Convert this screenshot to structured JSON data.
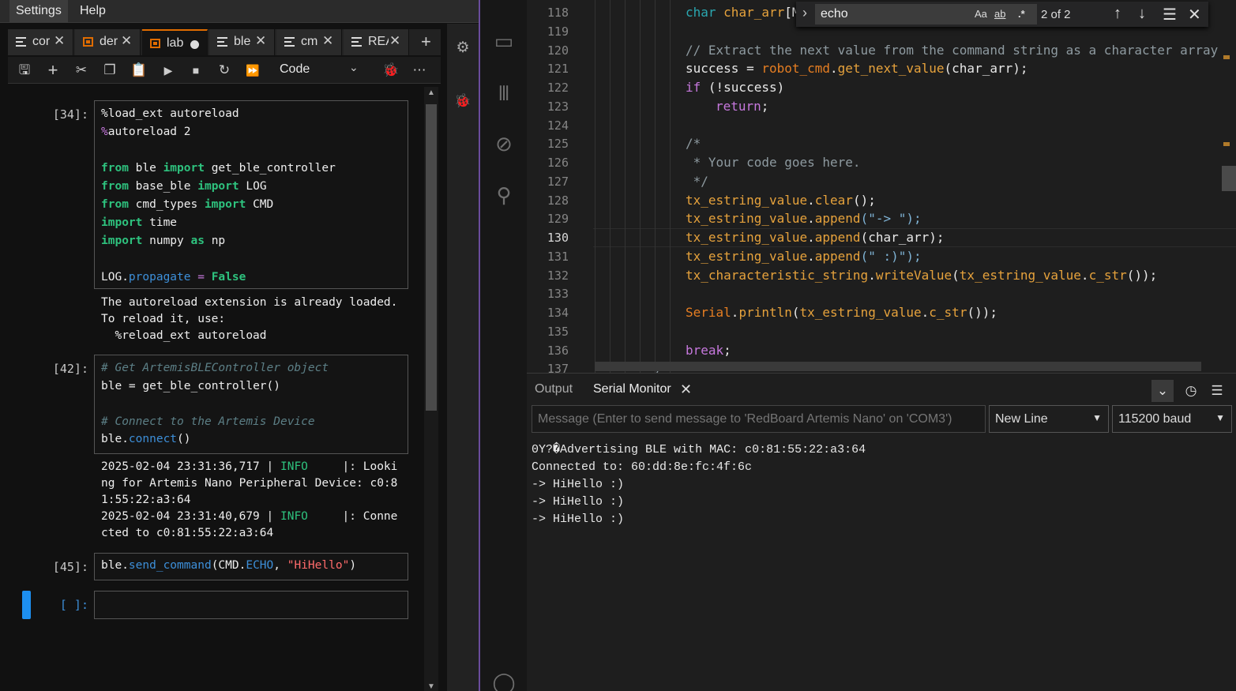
{
  "menubar": {
    "items": [
      "Settings",
      "Help"
    ]
  },
  "notebook_tabs": [
    {
      "label": "cor",
      "active": false,
      "dirty": false,
      "icon": "text-file-icon"
    },
    {
      "label": "der",
      "active": false,
      "dirty": false,
      "icon": "notebook-icon"
    },
    {
      "label": "lab",
      "active": true,
      "dirty": true,
      "icon": "notebook-icon"
    },
    {
      "label": "ble",
      "active": false,
      "dirty": false,
      "icon": "text-file-icon"
    },
    {
      "label": "cm",
      "active": false,
      "dirty": false,
      "icon": "text-file-icon"
    },
    {
      "label": "REA",
      "active": false,
      "dirty": false,
      "icon": "text-file-icon"
    }
  ],
  "toolbar": {
    "icons": [
      "save-icon",
      "add-cell-icon",
      "cut-icon",
      "copy-icon",
      "paste-icon",
      "run-icon",
      "stop-icon",
      "restart-icon",
      "run-all-icon"
    ],
    "cell_type": "Code"
  },
  "cells": {
    "c1": {
      "prompt": "[34]:",
      "line1": "%load_ext autoreload",
      "line2_mag": "%",
      "line2": "autoreload 2",
      "imp": {
        "from": "from",
        "import": "import",
        "as": "as",
        "m1": " ble ",
        "n1": " get_ble_controller",
        "m2": " base_ble ",
        "n2": " LOG",
        "m3": " cmd_types ",
        "n3": " CMD",
        "n4": " time",
        "n5": " numpy ",
        "n5b": " np"
      },
      "last_obj": "LOG.",
      "last_attr": "propagate",
      "last_eq": " = ",
      "last_val": "False",
      "output": "The autoreload extension is already loaded.\nTo reload it, use:\n  %reload_ext autoreload"
    },
    "c2": {
      "prompt": "[42]:",
      "comment1": "# Get ArtemisBLEController object",
      "l2a": "ble = ",
      "l2b": "get_ble_controller",
      "l2c": "()",
      "comment2": "# Connect to the Artemis Device",
      "l4a": "ble.",
      "l4b": "connect",
      "l4c": "()",
      "out": {
        "a": "2025-02-04 23:31:36,717 | ",
        "b": "INFO",
        "c": "     |: Looki\nng for Artemis Nano Peripheral Device: c0:8\n1:55:22:a3:64\n2025-02-04 23:31:40,679 | ",
        "d": "INFO",
        "e": "     |: Conne\ncted to c0:81:55:22:a3:64"
      }
    },
    "c3": {
      "prompt": "[45]:",
      "a": "ble.",
      "b": "send_command",
      "c": "(CMD.",
      "d": "ECHO",
      "e": ", ",
      "f": "\"HiHello\"",
      "g": ")"
    },
    "c4": {
      "prompt": "[ ]:"
    }
  },
  "editor": {
    "line_numbers": [
      "118",
      "119",
      "120",
      "121",
      "122",
      "123",
      "124",
      "125",
      "126",
      "127",
      "128",
      "129",
      "130",
      "131",
      "132",
      "133",
      "134",
      "135",
      "136",
      "137"
    ],
    "current_line": "130",
    "code": {
      "l118a": "char ",
      "l118b": "char_arr",
      "l118c": "[M",
      "l120": "// Extract the next value from the command string as a character array",
      "l121a": "success = ",
      "l121b": "robot_cmd",
      "l121c": ".",
      "l121d": "get_next_value",
      "l121e": "(char_arr);",
      "l122a": "if",
      "l122b": " (!success)",
      "l123a": "return",
      "l123b": ";",
      "l125": "/*",
      "l126": " * Your code goes here.",
      "l127": " */",
      "ts": "tx_estring_value",
      "dot": ".",
      "clear": "clear",
      "append": "append",
      "l128e": "();",
      "l129s": "(\"-> \");",
      "l130e": "(char_arr);",
      "l131s": "(\" :)\");",
      "tcs": "tx_characteristic_string",
      "write": "writeValue",
      "paren": "(",
      "cstr": "c_str",
      "l132e": "());",
      "serial": "Serial",
      "println": "println",
      "l134e": "());",
      "brk": "break",
      "semi": ";",
      "l137": "/*"
    },
    "find": {
      "query": "echo",
      "count": "2 of 2",
      "opt_case": "Aa",
      "opt_word": "ab",
      "opt_regex": ".*"
    }
  },
  "panel": {
    "tabs": [
      "Output",
      "Serial Monitor"
    ],
    "message_placeholder": "Message (Enter to send message to 'RedBoard Artemis Nano' on 'COM3')",
    "line_ending": "New Line",
    "baud": "115200 baud",
    "serial_lines": [
      "0Y?�Advertising BLE with MAC: c0:81:55:22:a3:64",
      "Connected to: 60:dd:8e:fc:4f:6c",
      "-> HiHello :)",
      "-> HiHello :)",
      "-> HiHello :)"
    ]
  }
}
